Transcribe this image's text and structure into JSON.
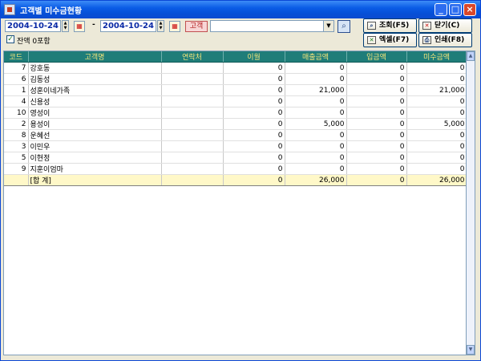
{
  "window": {
    "title": "고객별 미수금현황"
  },
  "filters": {
    "date_from": "2004-10-24",
    "separator": "-",
    "date_to": "2004-10-24",
    "customer_button": "고객",
    "customer_select_value": "",
    "include_zero_balance": {
      "label": "잔액 0포함",
      "checked": true
    }
  },
  "buttons": {
    "query": "조회(F5)",
    "close": "닫기(C)",
    "excel": "엑셀(F7)",
    "print": "인쇄(F8)"
  },
  "table": {
    "columns": [
      "코드",
      "고객명",
      "연락처",
      "이월",
      "매출금액",
      "입금액",
      "미수금액"
    ],
    "rows": [
      {
        "code": "7",
        "name": "강호동",
        "phone": "",
        "carry": "0",
        "sales": "0",
        "received": "0",
        "outstanding": "0"
      },
      {
        "code": "6",
        "name": "김동성",
        "phone": "",
        "carry": "0",
        "sales": "0",
        "received": "0",
        "outstanding": "0"
      },
      {
        "code": "1",
        "name": "성훈이네가족",
        "phone": "",
        "carry": "0",
        "sales": "21,000",
        "received": "0",
        "outstanding": "21,000"
      },
      {
        "code": "4",
        "name": "신용성",
        "phone": "",
        "carry": "0",
        "sales": "0",
        "received": "0",
        "outstanding": "0"
      },
      {
        "code": "10",
        "name": "영성이",
        "phone": "",
        "carry": "0",
        "sales": "0",
        "received": "0",
        "outstanding": "0"
      },
      {
        "code": "2",
        "name": "용성이",
        "phone": "",
        "carry": "0",
        "sales": "5,000",
        "received": "0",
        "outstanding": "5,000"
      },
      {
        "code": "8",
        "name": "운혜선",
        "phone": "",
        "carry": "0",
        "sales": "0",
        "received": "0",
        "outstanding": "0"
      },
      {
        "code": "3",
        "name": "이민우",
        "phone": "",
        "carry": "0",
        "sales": "0",
        "received": "0",
        "outstanding": "0"
      },
      {
        "code": "5",
        "name": "이현정",
        "phone": "",
        "carry": "0",
        "sales": "0",
        "received": "0",
        "outstanding": "0"
      },
      {
        "code": "9",
        "name": "지훈이엄마",
        "phone": "",
        "carry": "0",
        "sales": "0",
        "received": "0",
        "outstanding": "0"
      }
    ],
    "total": {
      "label": "[합 계]",
      "carry": "0",
      "sales": "26,000",
      "received": "0",
      "outstanding": "26,000"
    }
  },
  "colors": {
    "title_bar": "#0a5ce6",
    "header_bg": "#1f7d79",
    "header_text": "#f3e47a",
    "total_row_bg": "#fff8c8"
  },
  "icons": [
    "app-icon",
    "minimize-icon",
    "maximize-icon",
    "close-icon",
    "calendar-icon",
    "search-icon",
    "query-icon",
    "close-x-icon",
    "excel-icon",
    "print-icon"
  ]
}
